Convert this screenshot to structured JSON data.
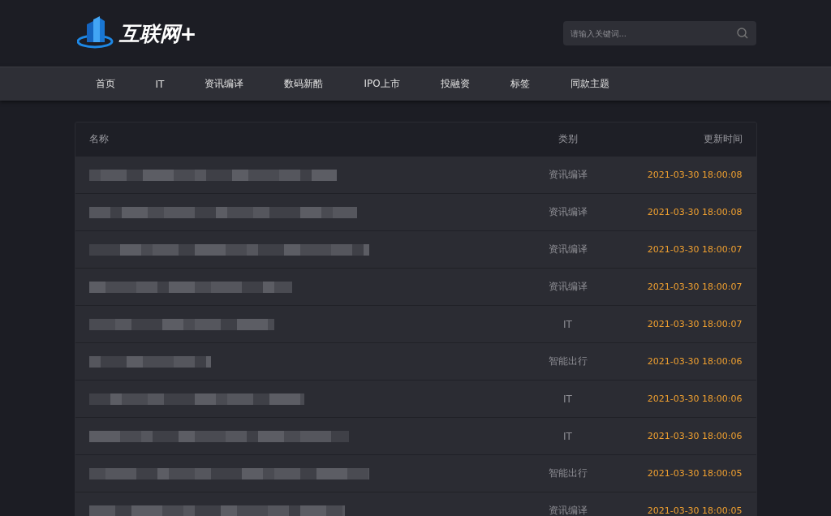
{
  "header": {
    "logo_text": "互联网+",
    "search": {
      "placeholder": "请输入关键词..."
    }
  },
  "nav": [
    {
      "label": "首页"
    },
    {
      "label": "IT"
    },
    {
      "label": "资讯编译"
    },
    {
      "label": "数码新酷"
    },
    {
      "label": "IPO上市"
    },
    {
      "label": "投融资"
    },
    {
      "label": "标签"
    },
    {
      "label": "同款主题"
    }
  ],
  "table": {
    "columns": [
      "名称",
      "类别",
      "更新时间"
    ],
    "rows": [
      {
        "category": "资讯编译",
        "time": "2021-03-30 18:00:08"
      },
      {
        "category": "资讯编译",
        "time": "2021-03-30 18:00:08"
      },
      {
        "category": "资讯编译",
        "time": "2021-03-30 18:00:07"
      },
      {
        "category": "资讯编译",
        "time": "2021-03-30 18:00:07"
      },
      {
        "category": "IT",
        "time": "2021-03-30 18:00:07"
      },
      {
        "category": "智能出行",
        "time": "2021-03-30 18:00:06"
      },
      {
        "category": "IT",
        "time": "2021-03-30 18:00:06"
      },
      {
        "category": "IT",
        "time": "2021-03-30 18:00:06"
      },
      {
        "category": "智能出行",
        "time": "2021-03-30 18:00:05"
      },
      {
        "category": "资讯编译",
        "time": "2021-03-30 18:00:05"
      }
    ]
  }
}
